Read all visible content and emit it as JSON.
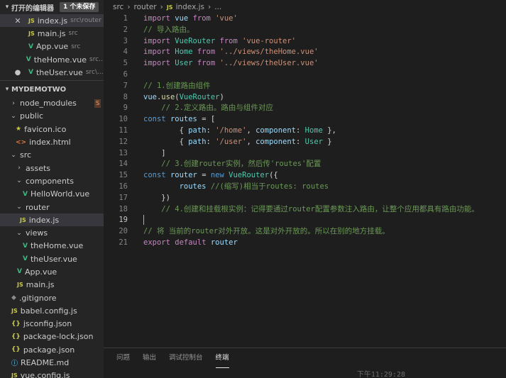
{
  "sidebar": {
    "open_editors": {
      "title": "打开的编辑器",
      "badge": "1 个未保存",
      "items": [
        {
          "icon": "JS",
          "name": "index.js",
          "desc": "src\\router"
        },
        {
          "icon": "JS",
          "name": "main.js",
          "desc": "src"
        },
        {
          "icon": "V",
          "name": "App.vue",
          "desc": "src"
        },
        {
          "icon": "V",
          "name": "theHome.vue",
          "desc": "src..."
        },
        {
          "icon": "V",
          "name": "theUser.vue",
          "desc": "src\\..."
        }
      ]
    },
    "project": {
      "title": "MYDEMOTWO",
      "node_modules": "node_modules",
      "node_modules_badge": "S",
      "public": "public",
      "favicon": "favicon.ico",
      "index_html": "index.html",
      "src": "src",
      "assets": "assets",
      "components": "components",
      "helloworld": "HelloWorld.vue",
      "router": "router",
      "router_index": "index.js",
      "views": "views",
      "thehome": "theHome.vue",
      "theuser": "theUser.vue",
      "appvue": "App.vue",
      "mainjs": "main.js",
      "gitignore": ".gitignore",
      "babel": "babel.config.js",
      "jsconfig": "jsconfig.json",
      "packagelock": "package-lock.json",
      "package": "package.json",
      "readme": "README.md",
      "vueconfig": "vue.config.js"
    }
  },
  "breadcrumb": {
    "src": "src",
    "router": "router",
    "file_icon": "JS",
    "file": "index.js",
    "more": "..."
  },
  "code": {
    "l1": "import vue from 'vue'",
    "l2": "// 导入路由。",
    "l3": "import VueRouter from 'vue-router'",
    "l4": "import Home from '../views/theHome.vue'",
    "l5": "import User from '../views/theUser.vue'",
    "l7": "// 1.创建路由组件",
    "l8": "vue.use(VueRouter)",
    "l9": "// 2.定义路由。路由与组件对应",
    "l10": "const routes = [",
    "l11": "{ path: '/home', component: Home },",
    "l12": "{ path: '/user', component: User }",
    "l13": "]",
    "l14": "// 3.创建router实例，然后传'routes'配置",
    "l15": "const router = new VueRouter({",
    "l16": "routes //(缩写)相当于routes: routes",
    "l17": "})",
    "l18": "// 4.创建和挂载根实例：记得要通过router配置参数注入路由，让整个应用都具有路由功能。",
    "l20": "// 将 当前的router对外开放。这是对外开放的。所以在别的地方挂载。",
    "l21": "export default router"
  },
  "panel": {
    "tabs": [
      "问题",
      "输出",
      "调试控制台",
      "终端"
    ],
    "active_tab": "终端",
    "time": "下午11:29:28"
  }
}
